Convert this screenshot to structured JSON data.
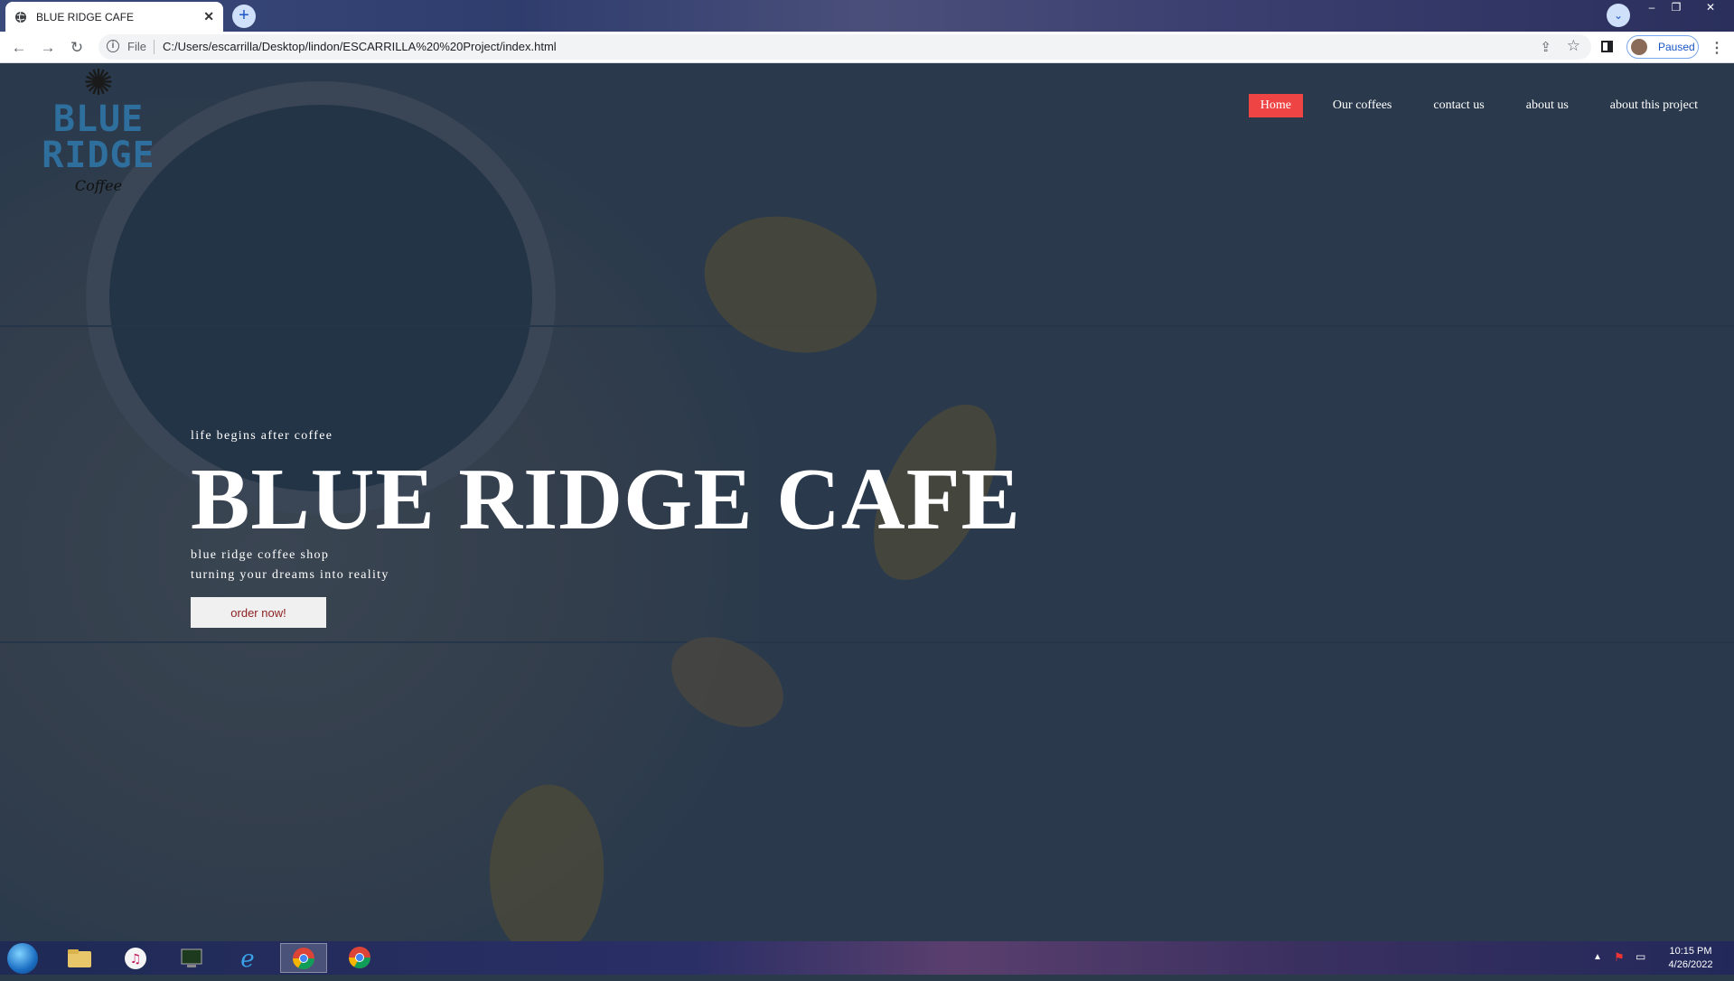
{
  "browser": {
    "tab_title": "BLUE RIDGE CAFE",
    "tab_close": "✕",
    "new_tab": "+",
    "address_scheme_label": "File",
    "url": "C:/Users/escarrilla/Desktop/lindon/ESCARRILLA%20%20Project/index.html",
    "profile_status": "Paused",
    "icons": [
      "globe-icon",
      "back-icon",
      "forward-icon",
      "reload-icon",
      "info-icon",
      "share-icon",
      "star-icon",
      "side-panel-icon",
      "avatar",
      "menu-icon"
    ]
  },
  "window_controls": {
    "tab_search": "⌄",
    "minimize": "–",
    "restore": "❐",
    "close": "✕"
  },
  "site": {
    "logo": {
      "line1": "BLUE",
      "line2": "RIDGE",
      "line3": "Coffee"
    },
    "nav": [
      {
        "label": "Home",
        "active": true
      },
      {
        "label": "Our coffees",
        "active": false
      },
      {
        "label": "contact us",
        "active": false
      },
      {
        "label": "about us",
        "active": false
      },
      {
        "label": "about this project",
        "active": false
      }
    ],
    "hero": {
      "tagline": "life begins after coffee",
      "title": "BLUE RIDGE CAFE",
      "sub1": "blue ridge coffee shop",
      "sub2": "turning your dreams into reality",
      "button": "order now!"
    },
    "colors": {
      "overlay": "#2a3a4c",
      "nav_active": "#ef4444",
      "button_text": "#8b1e1e"
    }
  },
  "taskbar": {
    "apps": [
      "windows-explorer-icon",
      "itunes-icon",
      "terminal-icon",
      "internet-explorer-icon",
      "chrome-icon",
      "chrome-icon"
    ],
    "time": "10:15 PM",
    "date": "4/26/2022"
  }
}
